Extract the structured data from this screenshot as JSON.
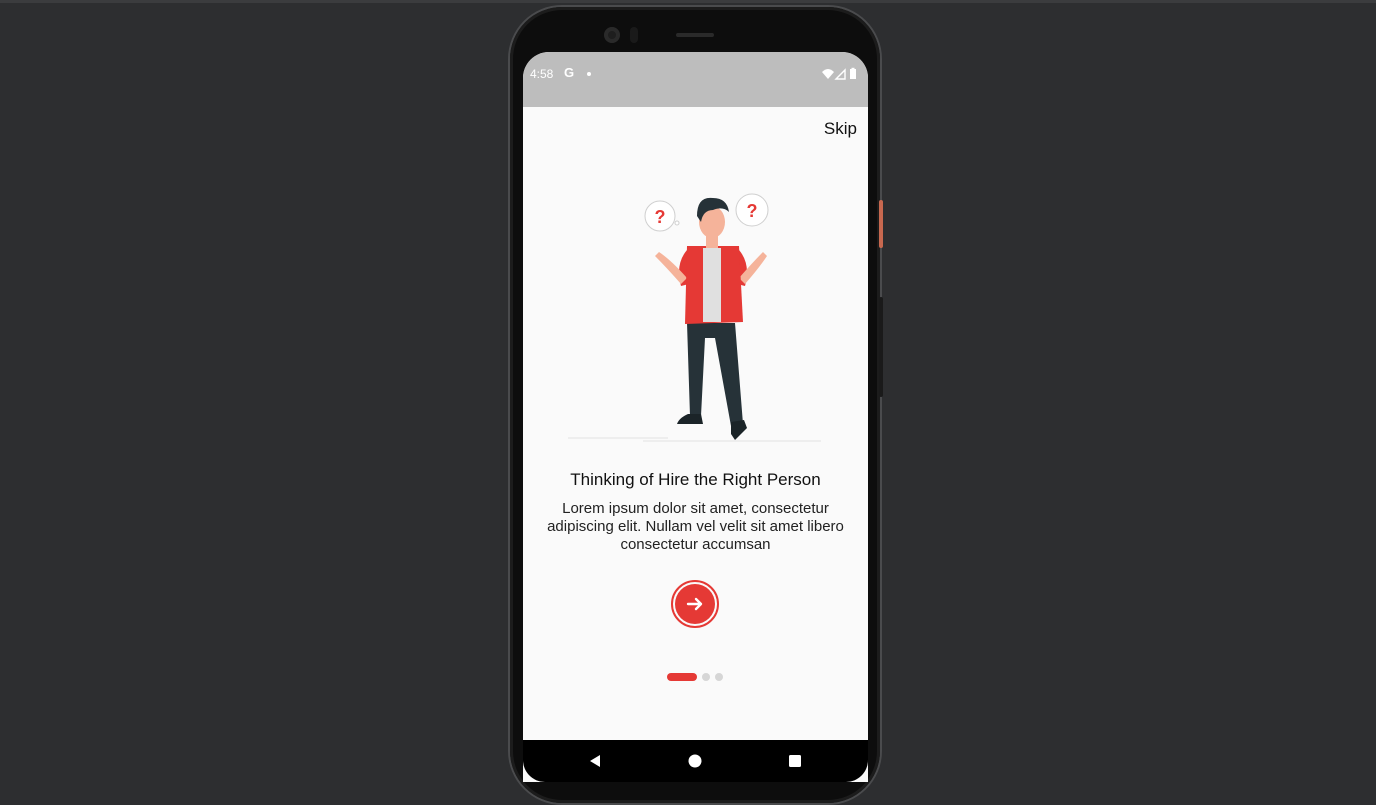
{
  "status_bar": {
    "time": "4:58",
    "google_glyph": "G",
    "icons": [
      "wifi-icon",
      "signal-icon",
      "battery-icon"
    ]
  },
  "onboarding": {
    "skip_label": "Skip",
    "title": "Thinking of Hire the Right Person",
    "description": "Lorem ipsum dolor sit amet, consectetur adipiscing elit. Nullam vel velit sit amet libero consectetur accumsan",
    "page_indicator": {
      "current": 1,
      "total": 3
    },
    "next_icon": "arrow-right-icon",
    "illustration": "confused-person-illustration"
  },
  "navigation_bar": {
    "buttons": [
      "back-icon",
      "home-icon",
      "recents-icon"
    ]
  },
  "colors": {
    "accent": "#e53935",
    "status_bar_bg": "#bdbdbd",
    "screen_bg": "#fafafa",
    "desktop_bg": "#2d2e30"
  }
}
